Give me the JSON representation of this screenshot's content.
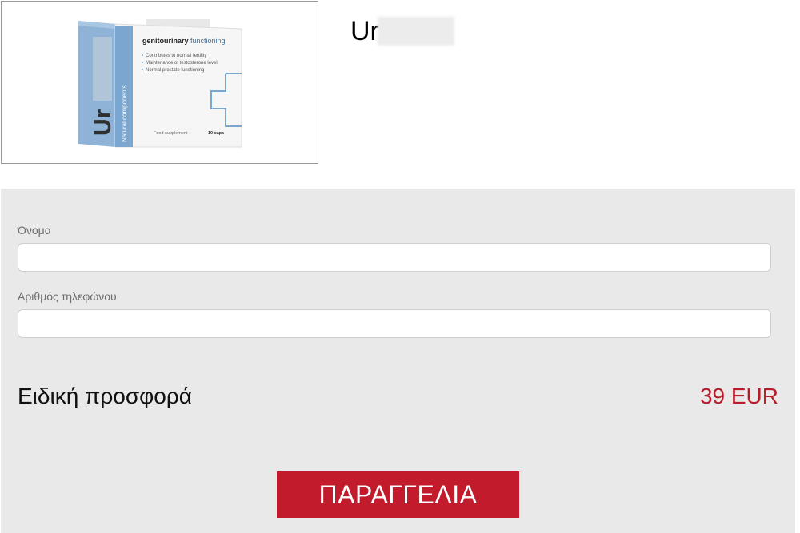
{
  "product": {
    "title_visible": "Ur",
    "box": {
      "heading_bold": "genitourinary",
      "heading_light": "functioning",
      "bullets": [
        "Contributes to normal fertility",
        "Maintenance of testosterone level",
        "Normal prostate functioning"
      ],
      "spine_text": "Natural components",
      "brand_partial": "Ur",
      "footer_left": "Food supplement",
      "footer_right": "10 caps"
    }
  },
  "form": {
    "name_label": "Όνομα",
    "name_value": "",
    "phone_label": "Αριθμός τηλεφώνου",
    "phone_value": ""
  },
  "offer": {
    "label": "Ειδική προσφορά",
    "price": "39 EUR"
  },
  "order_button": "ΠΑΡΑΓΓΕΛΙΑ",
  "colors": {
    "accent": "#c21b2b",
    "price": "#b71c2b",
    "panel": "#e9e9e9",
    "box_blue": "#7aa6d0"
  }
}
